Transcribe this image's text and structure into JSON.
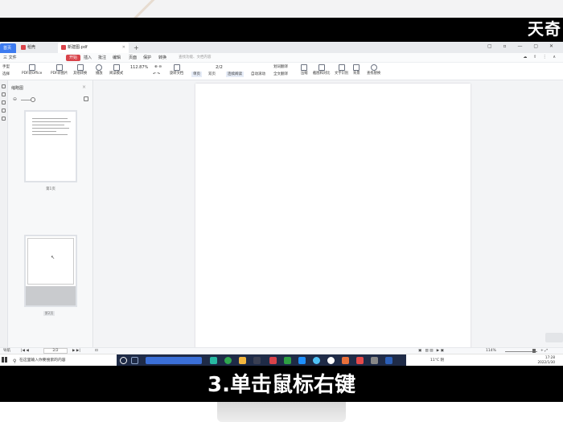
{
  "watermark": "天奇",
  "subtitle": "3.单击鼠标右键",
  "tabs": [
    {
      "label": "首页"
    },
    {
      "label": "稻壳"
    },
    {
      "label": "新建图.pdf"
    }
  ],
  "menu": {
    "file": "三 文件",
    "items": [
      "开始",
      "插入",
      "批注",
      "编辑",
      "页面",
      "保护",
      "转换"
    ],
    "search": "查找功能、文档内容"
  },
  "ribbon": {
    "hand": "手型",
    "select": "选择",
    "pdf_to_office": "PDF转Office",
    "pdf_to_image": "PDF转图片",
    "play": "播放",
    "read_mode": "阅读模式",
    "zoom": "112.87%",
    "page": "2/2",
    "rotate": "旋转文档",
    "single_page": "单页",
    "double_page": "双页",
    "continuous": "连续阅读",
    "auto_scroll": "自动滚动",
    "translate": "划词翻译",
    "full_translate": "全文翻译",
    "compress": "压缩",
    "screenshot": "截图和对比",
    "find_replace": "文字识别",
    "background": "背景",
    "find": "查找替换"
  },
  "thumbnails": {
    "title": "缩略图",
    "page1_label": "第1页",
    "page2_label": "第2页"
  },
  "statusbar": {
    "nav": "导航",
    "page": "2/2",
    "zoom": "114%"
  },
  "taskbar": {
    "search_placeholder": "在这里输入你要搜索的内容",
    "weather": "11°C 阴",
    "time": "17:28",
    "date": "2022/1/30"
  },
  "colors": {
    "accent": "#3d7bf0",
    "brand_red": "#d9434a",
    "taskbar_dark": "#1f2b47"
  }
}
